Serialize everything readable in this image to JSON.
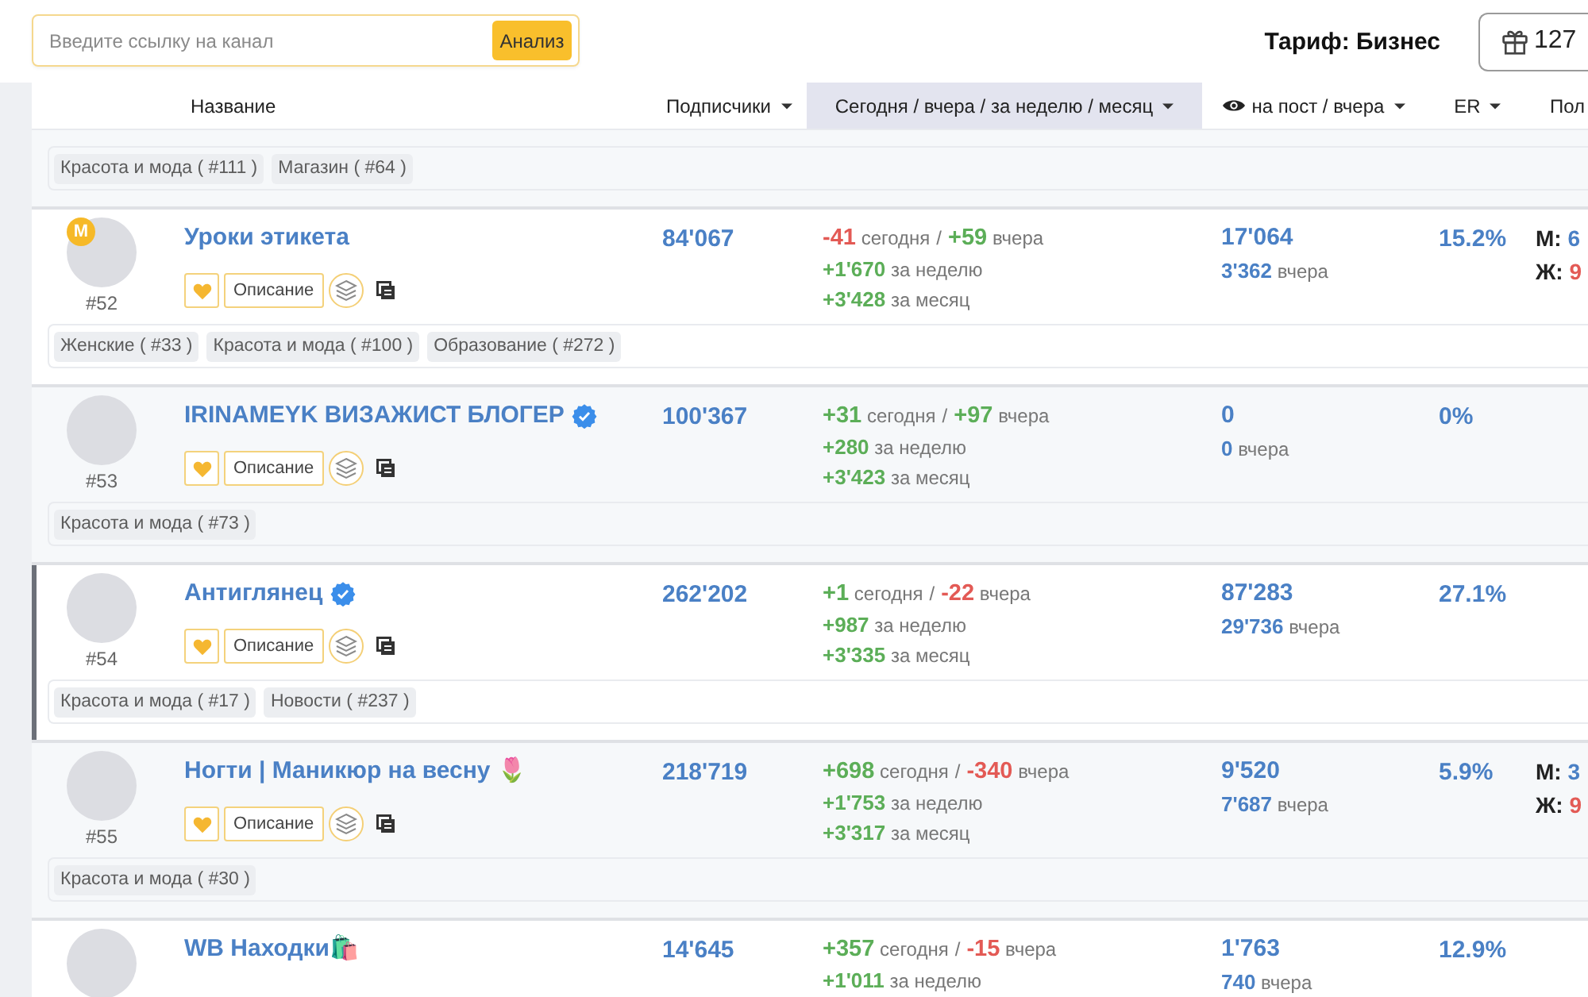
{
  "search": {
    "placeholder": "Введите ссылку на канал",
    "button": "Анализ"
  },
  "plan": "Тариф: Бизнес",
  "gift_button": {
    "count": "127"
  },
  "columns": [
    {
      "label": "Название",
      "kind": "name",
      "sortable": false,
      "selected": false
    },
    {
      "label": "Подписчики",
      "kind": "subscribers",
      "sortable": true,
      "selected": false
    },
    {
      "label": "Сегодня / вчера / за неделю / месяц",
      "kind": "growth",
      "sortable": true,
      "selected": true
    },
    {
      "label": "на пост / вчера",
      "kind": "views",
      "sortable": true,
      "selected": false
    },
    {
      "label": "ER",
      "kind": "er",
      "sortable": true,
      "selected": false
    },
    {
      "label": "Пол",
      "kind": "gender",
      "sortable": false,
      "selected": false
    }
  ],
  "rows": [
    {
      "selected": false,
      "tags": [
        "Красота и мода ( #111 )",
        "Магазин ( #64 )"
      ]
    },
    {
      "selected": false,
      "rank": "#52",
      "badge": "М",
      "name": "Уроки этикета",
      "verified": false,
      "description_button": "Описание",
      "subscribers": "84'067",
      "growth": [
        {
          "separator": "/",
          "parts": [
            {
              "change": "-41",
              "negative": true,
              "period": "сегодня"
            },
            {
              "change": "+59",
              "negative": false,
              "period": "вчера"
            }
          ]
        },
        {
          "parts": [
            {
              "change": "+1'670",
              "negative": false,
              "period": "за неделю"
            }
          ]
        },
        {
          "parts": [
            {
              "change": "+3'428",
              "negative": false,
              "period": "за месяц"
            }
          ]
        }
      ],
      "views": "17'064",
      "views_yesterday": {
        "count": "3'362",
        "period": "вчера"
      },
      "er": "15.2%",
      "gender": [
        {
          "kind": "male",
          "label": "М:",
          "value": "6"
        },
        {
          "kind": "female",
          "label": "Ж:",
          "value": "9"
        }
      ],
      "tags": [
        "Женские ( #33 )",
        "Красота и мода ( #100 )",
        "Образование ( #272 )"
      ]
    },
    {
      "selected": false,
      "rank": "#53",
      "name": "IRINAMEYK ВИЗАЖИСТ БЛОГЕР",
      "verified": true,
      "description_button": "Описание",
      "subscribers": "100'367",
      "growth": [
        {
          "separator": "/",
          "parts": [
            {
              "change": "+31",
              "negative": false,
              "period": "сегодня"
            },
            {
              "change": "+97",
              "negative": false,
              "period": "вчера"
            }
          ]
        },
        {
          "parts": [
            {
              "change": "+280",
              "negative": false,
              "period": "за неделю"
            }
          ]
        },
        {
          "parts": [
            {
              "change": "+3'423",
              "negative": false,
              "period": "за месяц"
            }
          ]
        }
      ],
      "views": "0",
      "views_yesterday": {
        "count": "0",
        "period": "вчера"
      },
      "er": "0%",
      "tags": [
        "Красота и мода ( #73 )"
      ]
    },
    {
      "selected": true,
      "rank": "#54",
      "name": "Антиглянец",
      "verified": true,
      "description_button": "Описание",
      "subscribers": "262'202",
      "growth": [
        {
          "separator": "/",
          "parts": [
            {
              "change": "+1",
              "negative": false,
              "period": "сегодня"
            },
            {
              "change": "-22",
              "negative": true,
              "period": "вчера"
            }
          ]
        },
        {
          "parts": [
            {
              "change": "+987",
              "negative": false,
              "period": "за неделю"
            }
          ]
        },
        {
          "parts": [
            {
              "change": "+3'335",
              "negative": false,
              "period": "за месяц"
            }
          ]
        }
      ],
      "views": "87'283",
      "views_yesterday": {
        "count": "29'736",
        "period": "вчера"
      },
      "er": "27.1%",
      "tags": [
        "Красота и мода ( #17 )",
        "Новости ( #237 )"
      ]
    },
    {
      "selected": false,
      "rank": "#55",
      "name": "Ногти | Маникюр на весну 🌷",
      "verified": false,
      "description_button": "Описание",
      "subscribers": "218'719",
      "growth": [
        {
          "separator": "/",
          "parts": [
            {
              "change": "+698",
              "negative": false,
              "period": "сегодня"
            },
            {
              "change": "-340",
              "negative": true,
              "period": "вчера"
            }
          ]
        },
        {
          "parts": [
            {
              "change": "+1'753",
              "negative": false,
              "period": "за неделю"
            }
          ]
        },
        {
          "parts": [
            {
              "change": "+3'317",
              "negative": false,
              "period": "за месяц"
            }
          ]
        }
      ],
      "views": "9'520",
      "views_yesterday": {
        "count": "7'687",
        "period": "вчера"
      },
      "er": "5.9%",
      "gender": [
        {
          "kind": "male",
          "label": "М:",
          "value": "3"
        },
        {
          "kind": "female",
          "label": "Ж:",
          "value": "9"
        }
      ],
      "tags": [
        "Красота и мода ( #30 )"
      ]
    },
    {
      "selected": false,
      "name": "WB Находки🛍️",
      "verified": false,
      "subscribers": "14'645",
      "growth": [
        {
          "separator": "/",
          "parts": [
            {
              "change": "+357",
              "negative": false,
              "period": "сегодня"
            },
            {
              "change": "-15",
              "negative": true,
              "period": "вчера"
            }
          ]
        },
        {
          "parts": [
            {
              "change": "+1'011",
              "negative": false,
              "period": "за неделю"
            }
          ]
        }
      ],
      "views": "1'763",
      "views_yesterday": {
        "count": "740",
        "period": "вчера"
      },
      "er": "12.9%"
    }
  ]
}
